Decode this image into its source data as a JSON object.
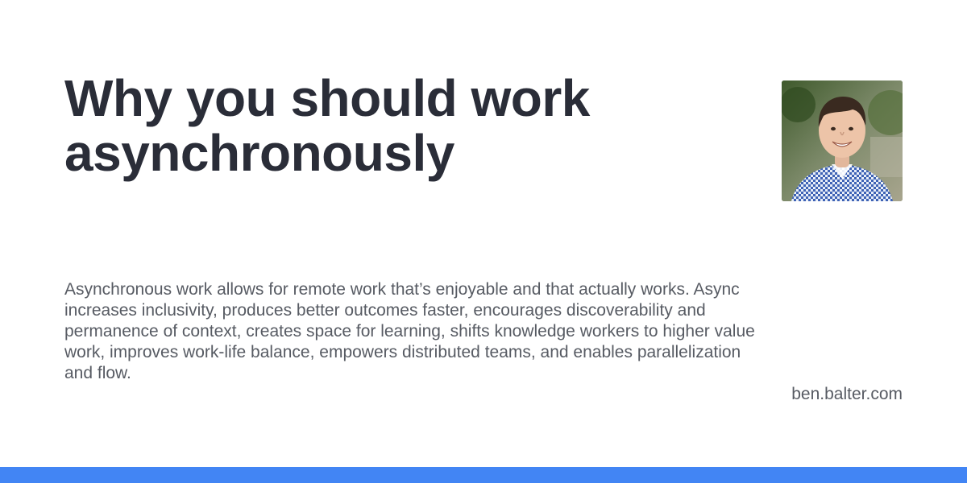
{
  "card": {
    "title": "Why you should work asynchronously",
    "description": "Asynchronous work allows for remote work that’s enjoyable and that actually works. Async increases inclusivity, produces better outcomes faster, encourages discoverability and permanence of context, creates space for learning, shifts knowledge workers to higher value work, improves work-life balance, empowers distributed teams, and enables parallelization and flow.",
    "site": "ben.balter.com",
    "avatar_icon": "author-photo",
    "accent_color": "#4285f4",
    "title_color": "#2a2d38",
    "text_color": "#575b63"
  }
}
